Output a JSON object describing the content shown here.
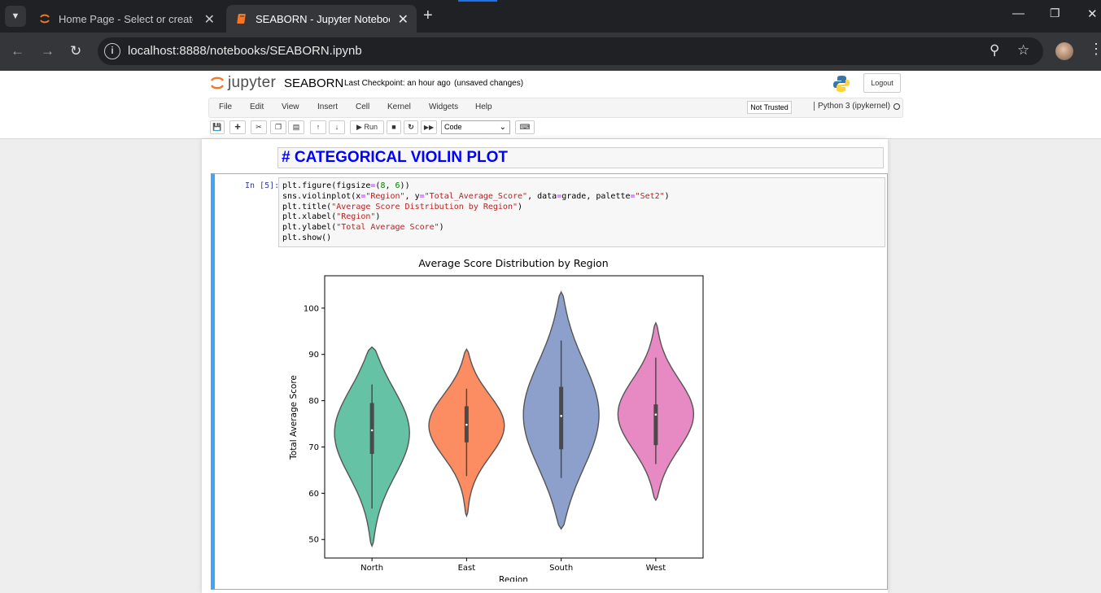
{
  "browser": {
    "tabs": [
      {
        "title": "Home Page - Select or create a notebook",
        "active": false
      },
      {
        "title": "SEABORN - Jupyter Notebook",
        "active": true
      }
    ],
    "url": "localhost:8888/notebooks/SEABORN.ipynb"
  },
  "jupyter": {
    "logo_text": "jupyter",
    "notebook_name": "SEABORN",
    "checkpoint": "Last Checkpoint: an hour ago",
    "unsaved": "(unsaved changes)",
    "logout": "Logout",
    "menu": [
      "File",
      "Edit",
      "View",
      "Insert",
      "Cell",
      "Kernel",
      "Widgets",
      "Help"
    ],
    "trusted": "Not Trusted",
    "kernel": "Python 3 (ipykernel)",
    "toolbar": {
      "run": "Run",
      "cell_type": "Code"
    }
  },
  "cells": {
    "markdown": "# CATEGORICAL VIOLIN PLOT",
    "prompt": "In [5]:",
    "code": [
      "plt.figure(figsize=(8, 6))",
      "sns.violinplot(x=\"Region\", y=\"Total_Average_Score\", data=grade, palette=\"Set2\")",
      "plt.title(\"Average Score Distribution by Region\")",
      "plt.xlabel(\"Region\")",
      "plt.ylabel(\"Total Average Score\")",
      "plt.show()"
    ]
  },
  "chart_data": {
    "type": "violin",
    "title": "Average Score Distribution by Region",
    "xlabel": "Region",
    "ylabel": "Total Average Score",
    "ylim": [
      46,
      107
    ],
    "yticks": [
      50,
      60,
      70,
      80,
      90,
      100
    ],
    "categories": [
      "North",
      "East",
      "South",
      "West"
    ],
    "colors": [
      "#66c2a5",
      "#fc8d62",
      "#8da0cb",
      "#e78ac3"
    ],
    "violins": [
      {
        "category": "North",
        "min": 48.6,
        "max": 91.6,
        "q1": 68.5,
        "median": 73.6,
        "q3": 79.5,
        "whisker_low": 56.7,
        "whisker_high": 83.5
      },
      {
        "category": "East",
        "min": 55.1,
        "max": 91.1,
        "q1": 71.0,
        "median": 74.8,
        "q3": 78.8,
        "whisker_low": 63.7,
        "whisker_high": 82.6
      },
      {
        "category": "South",
        "min": 52.3,
        "max": 103.5,
        "q1": 69.5,
        "median": 76.7,
        "q3": 83.0,
        "whisker_low": 63.3,
        "whisker_high": 93.0
      },
      {
        "category": "West",
        "min": 58.5,
        "max": 96.8,
        "q1": 70.4,
        "median": 77.0,
        "q3": 79.2,
        "whisker_low": 66.3,
        "whisker_high": 89.3
      }
    ]
  }
}
